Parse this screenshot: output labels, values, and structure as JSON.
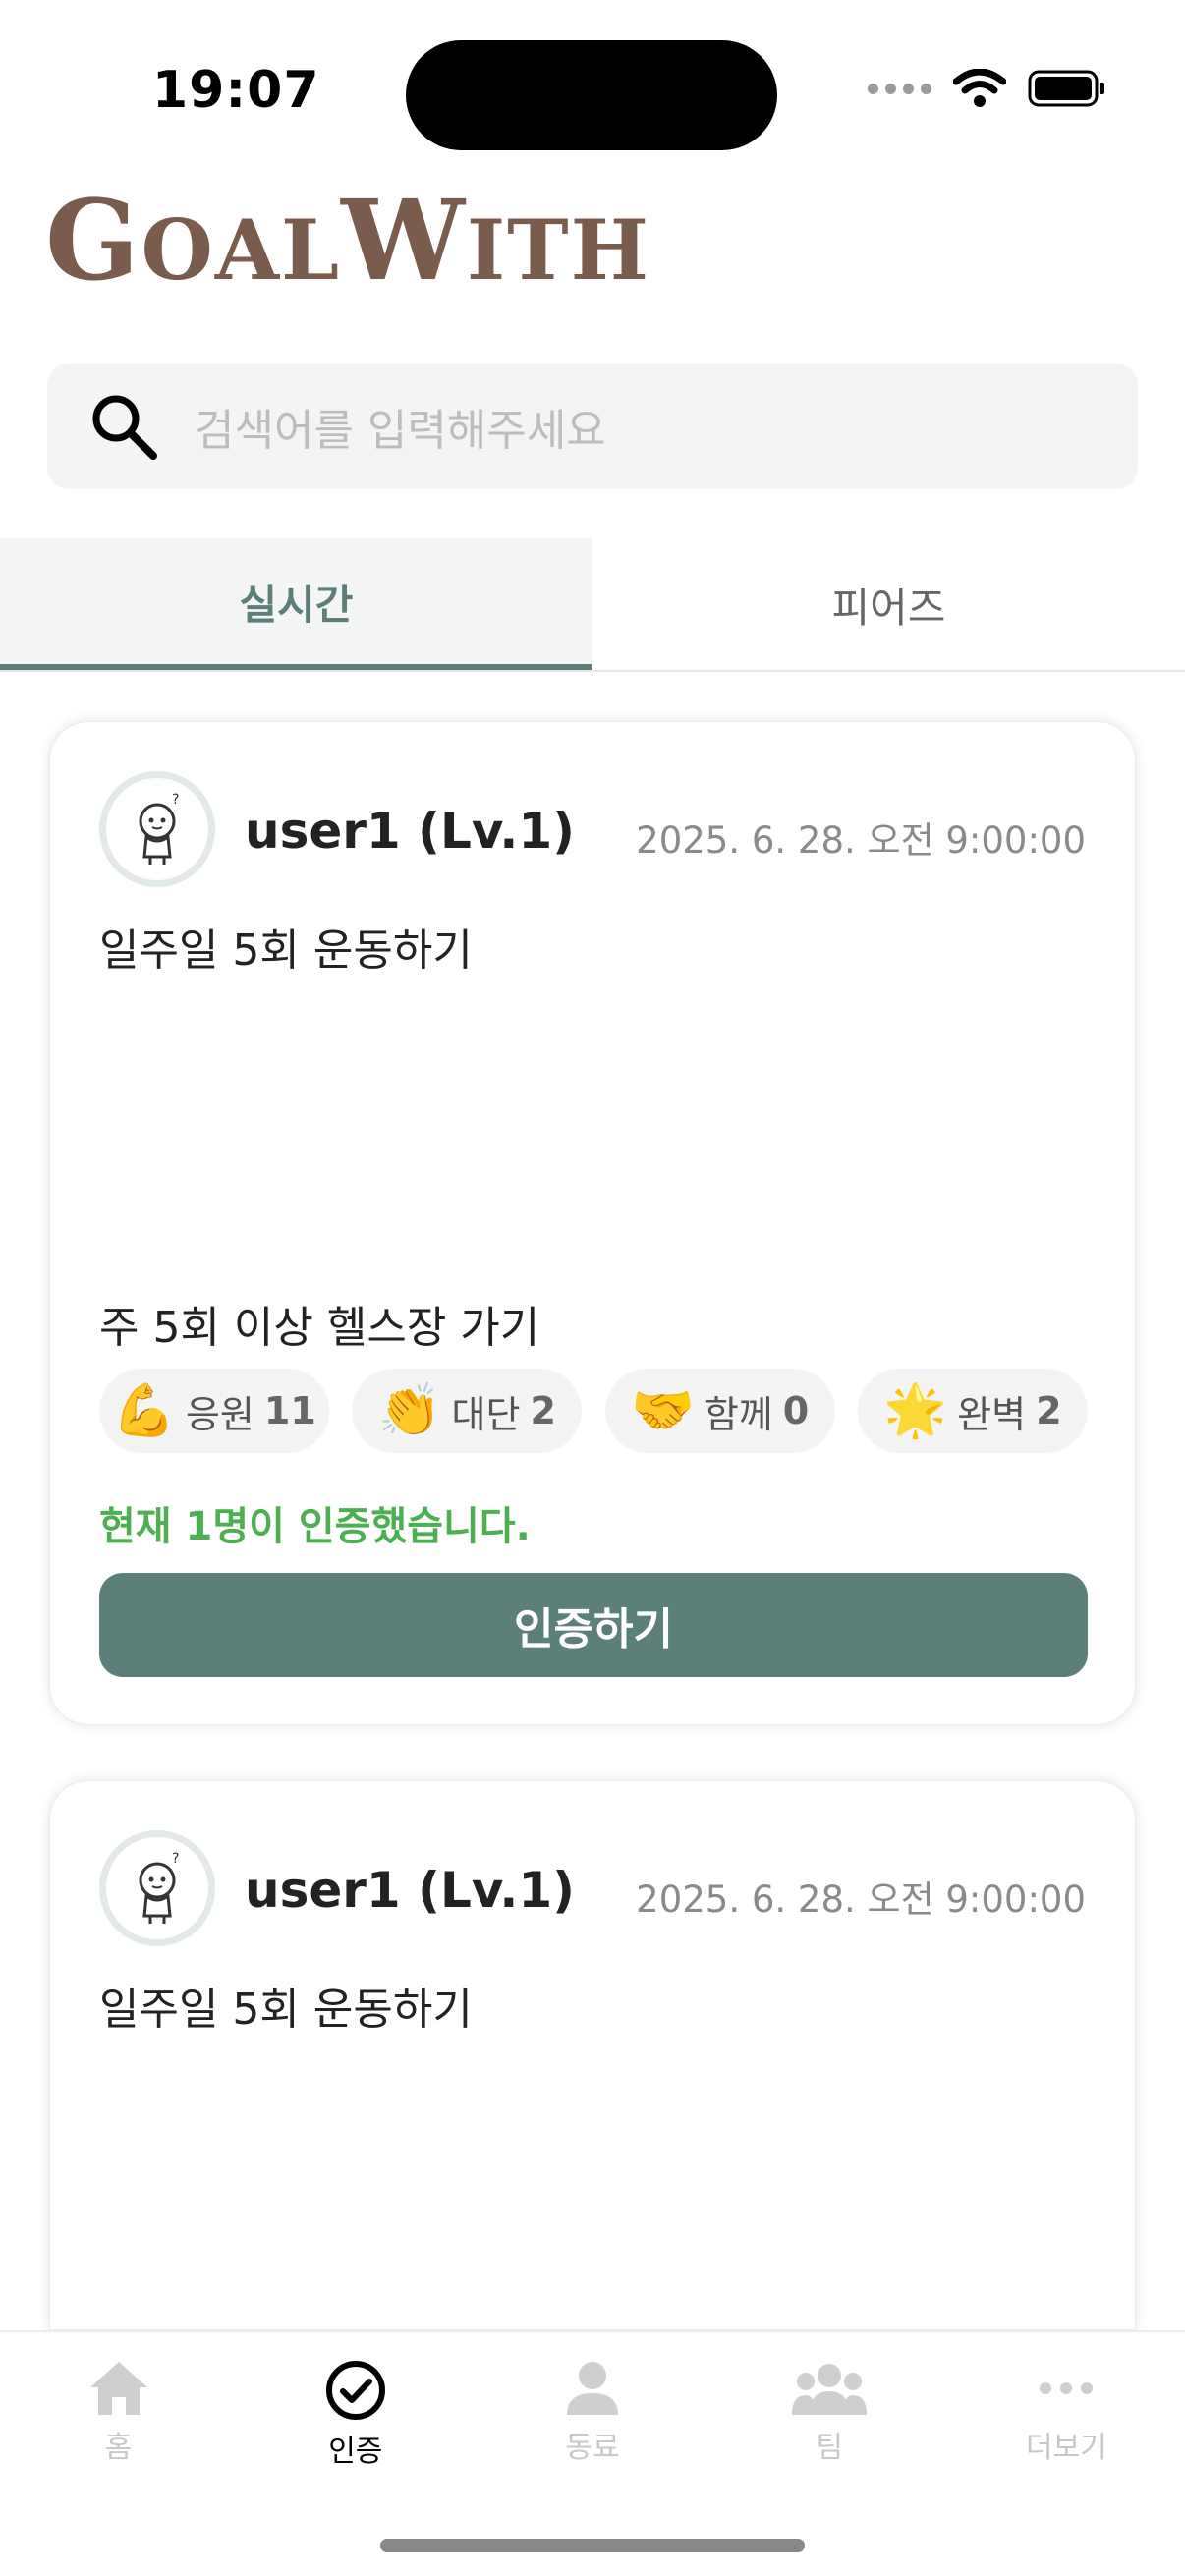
{
  "status_bar": {
    "time": "19:07"
  },
  "app": {
    "logo": "GoalWith",
    "logo_parts": [
      "G",
      "OAL",
      "W",
      "ITH"
    ]
  },
  "search": {
    "placeholder": "검색어를 입력해주세요"
  },
  "tabs": [
    {
      "label": "실시간",
      "active": true
    },
    {
      "label": "피어즈",
      "active": false
    }
  ],
  "posts": [
    {
      "username": "user1 (Lv.1)",
      "timestamp": "2025. 6. 28. 오전 9:00:00",
      "goal_title": "일주일 5회 운동하기",
      "goal_desc": "주 5회 이상 헬스장 가기",
      "reactions": [
        {
          "emoji": "💪",
          "label": "응원",
          "count": "11"
        },
        {
          "emoji": "👏",
          "label": "대단",
          "count": "2"
        },
        {
          "emoji": "🤝",
          "label": "함께",
          "count": "0"
        },
        {
          "emoji": "🌟",
          "label": "완벽",
          "count": "2"
        }
      ],
      "status_text": "현재 1명이 인증했습니다.",
      "button_label": "인증하기"
    },
    {
      "username": "user1 (Lv.1)",
      "timestamp": "2025. 6. 28. 오전 9:00:00",
      "goal_title": "일주일 5회 운동하기"
    }
  ],
  "bottom_nav": [
    {
      "label": "홈",
      "icon": "home-icon",
      "active": false
    },
    {
      "label": "인증",
      "icon": "check-circle-icon",
      "active": true
    },
    {
      "label": "동료",
      "icon": "person-icon",
      "active": false
    },
    {
      "label": "팀",
      "icon": "team-icon",
      "active": false
    },
    {
      "label": "더보기",
      "icon": "more-icon",
      "active": false
    }
  ],
  "colors": {
    "accent": "#5c7f7a",
    "logo": "#7a5c4c",
    "success": "#4caf50"
  }
}
